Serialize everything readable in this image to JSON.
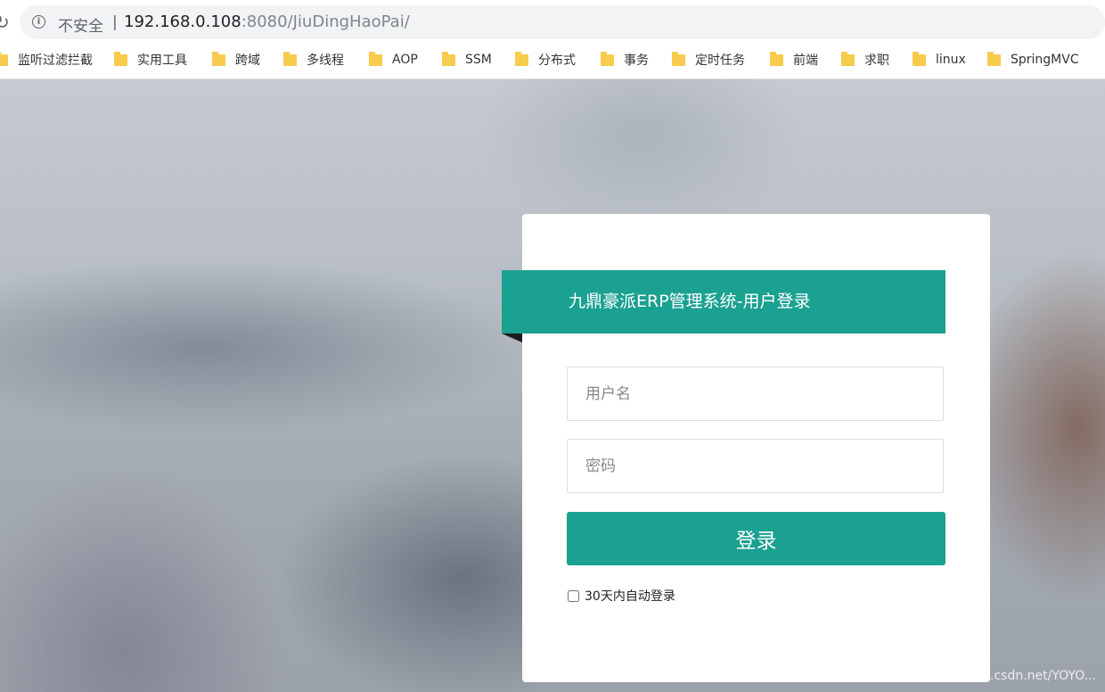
{
  "browser": {
    "security_label": "不安全",
    "separator": "|",
    "url_host": "192.168.0.108",
    "url_rest": ":8080/JiuDingHaoPai/"
  },
  "bookmarks": [
    {
      "label": "监听过滤拦截",
      "icon": "folder-icon"
    },
    {
      "label": "实用工具",
      "icon": "folder-icon"
    },
    {
      "label": "跨域",
      "icon": "folder-icon"
    },
    {
      "label": "多线程",
      "icon": "folder-icon"
    },
    {
      "label": "AOP",
      "icon": "folder-icon"
    },
    {
      "label": "SSM",
      "icon": "folder-icon"
    },
    {
      "label": "分布式",
      "icon": "folder-icon"
    },
    {
      "label": "事务",
      "icon": "folder-icon"
    },
    {
      "label": "定时任务",
      "icon": "folder-icon"
    },
    {
      "label": "前端",
      "icon": "folder-icon"
    },
    {
      "label": "求职",
      "icon": "folder-icon"
    },
    {
      "label": "linux",
      "icon": "folder-icon"
    },
    {
      "label": "SpringMVC",
      "icon": "folder-icon"
    }
  ],
  "login": {
    "title": "九鼎豪派ERP管理系统-用户登录",
    "username_placeholder": "用户名",
    "password_placeholder": "密码",
    "submit_label": "登录",
    "remember_label": "30天内自动登录",
    "remember_checked": false
  },
  "watermark": "https://blog.csdn.net/YOYO...",
  "colors": {
    "accent": "#1aa191",
    "folder": "#f7cb4d"
  }
}
